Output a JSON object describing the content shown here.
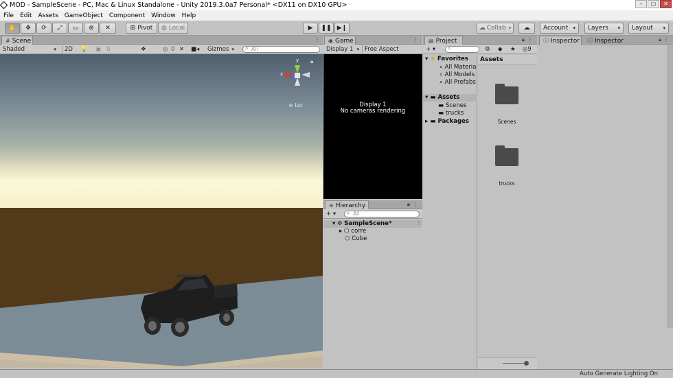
{
  "window": {
    "title": "MOD - SampleScene - PC, Mac & Linux Standalone - Unity 2019.3.0a7 Personal* <DX11 on DX10 GPU>"
  },
  "menu": [
    "File",
    "Edit",
    "Assets",
    "GameObject",
    "Component",
    "Window",
    "Help"
  ],
  "toolbar": {
    "pivot_label": "Pivot",
    "local_label": "Local",
    "collab_label": "Collab",
    "account_label": "Account",
    "layers_label": "Layers",
    "layout_label": "Layout"
  },
  "scene": {
    "tab_label": "Scene",
    "shading_mode": "Shaded",
    "mode_2d": "2D",
    "fx_count": "0",
    "hidden_count": "0",
    "gizmos_label": "Gizmos",
    "search_placeholder": "All",
    "gizmo_label": "Iso",
    "gizmo_axes": [
      "y",
      "x"
    ]
  },
  "game": {
    "tab_label": "Game",
    "display": "Display 1",
    "aspect": "Free Aspect",
    "message_line1": "Display 1",
    "message_line2": "No cameras rendering"
  },
  "hierarchy": {
    "tab_label": "Hierarchy",
    "search_placeholder": "All",
    "scene_name": "SampleScene*",
    "items": [
      "corre",
      "Cube"
    ]
  },
  "project": {
    "tab_label": "Project",
    "hidden_count": "9",
    "favorites_label": "Favorites",
    "favorites": [
      "All Materia",
      "All Models",
      "All Prefabs"
    ],
    "assets_label": "Assets",
    "asset_folders": [
      "Scenes",
      "trucks"
    ],
    "packages_label": "Packages",
    "grid_header": "Assets",
    "grid_items": [
      "Scenes",
      "trucks"
    ]
  },
  "inspector": {
    "tabs": [
      "Inspector",
      "Inspector"
    ]
  },
  "status_bar": {
    "text": "Auto Generate Lighting On"
  },
  "colors": {
    "editor_bg": "#c2c2c2",
    "game_view": "#000000",
    "ground": "#51391a",
    "plane": "#7b8c96"
  }
}
